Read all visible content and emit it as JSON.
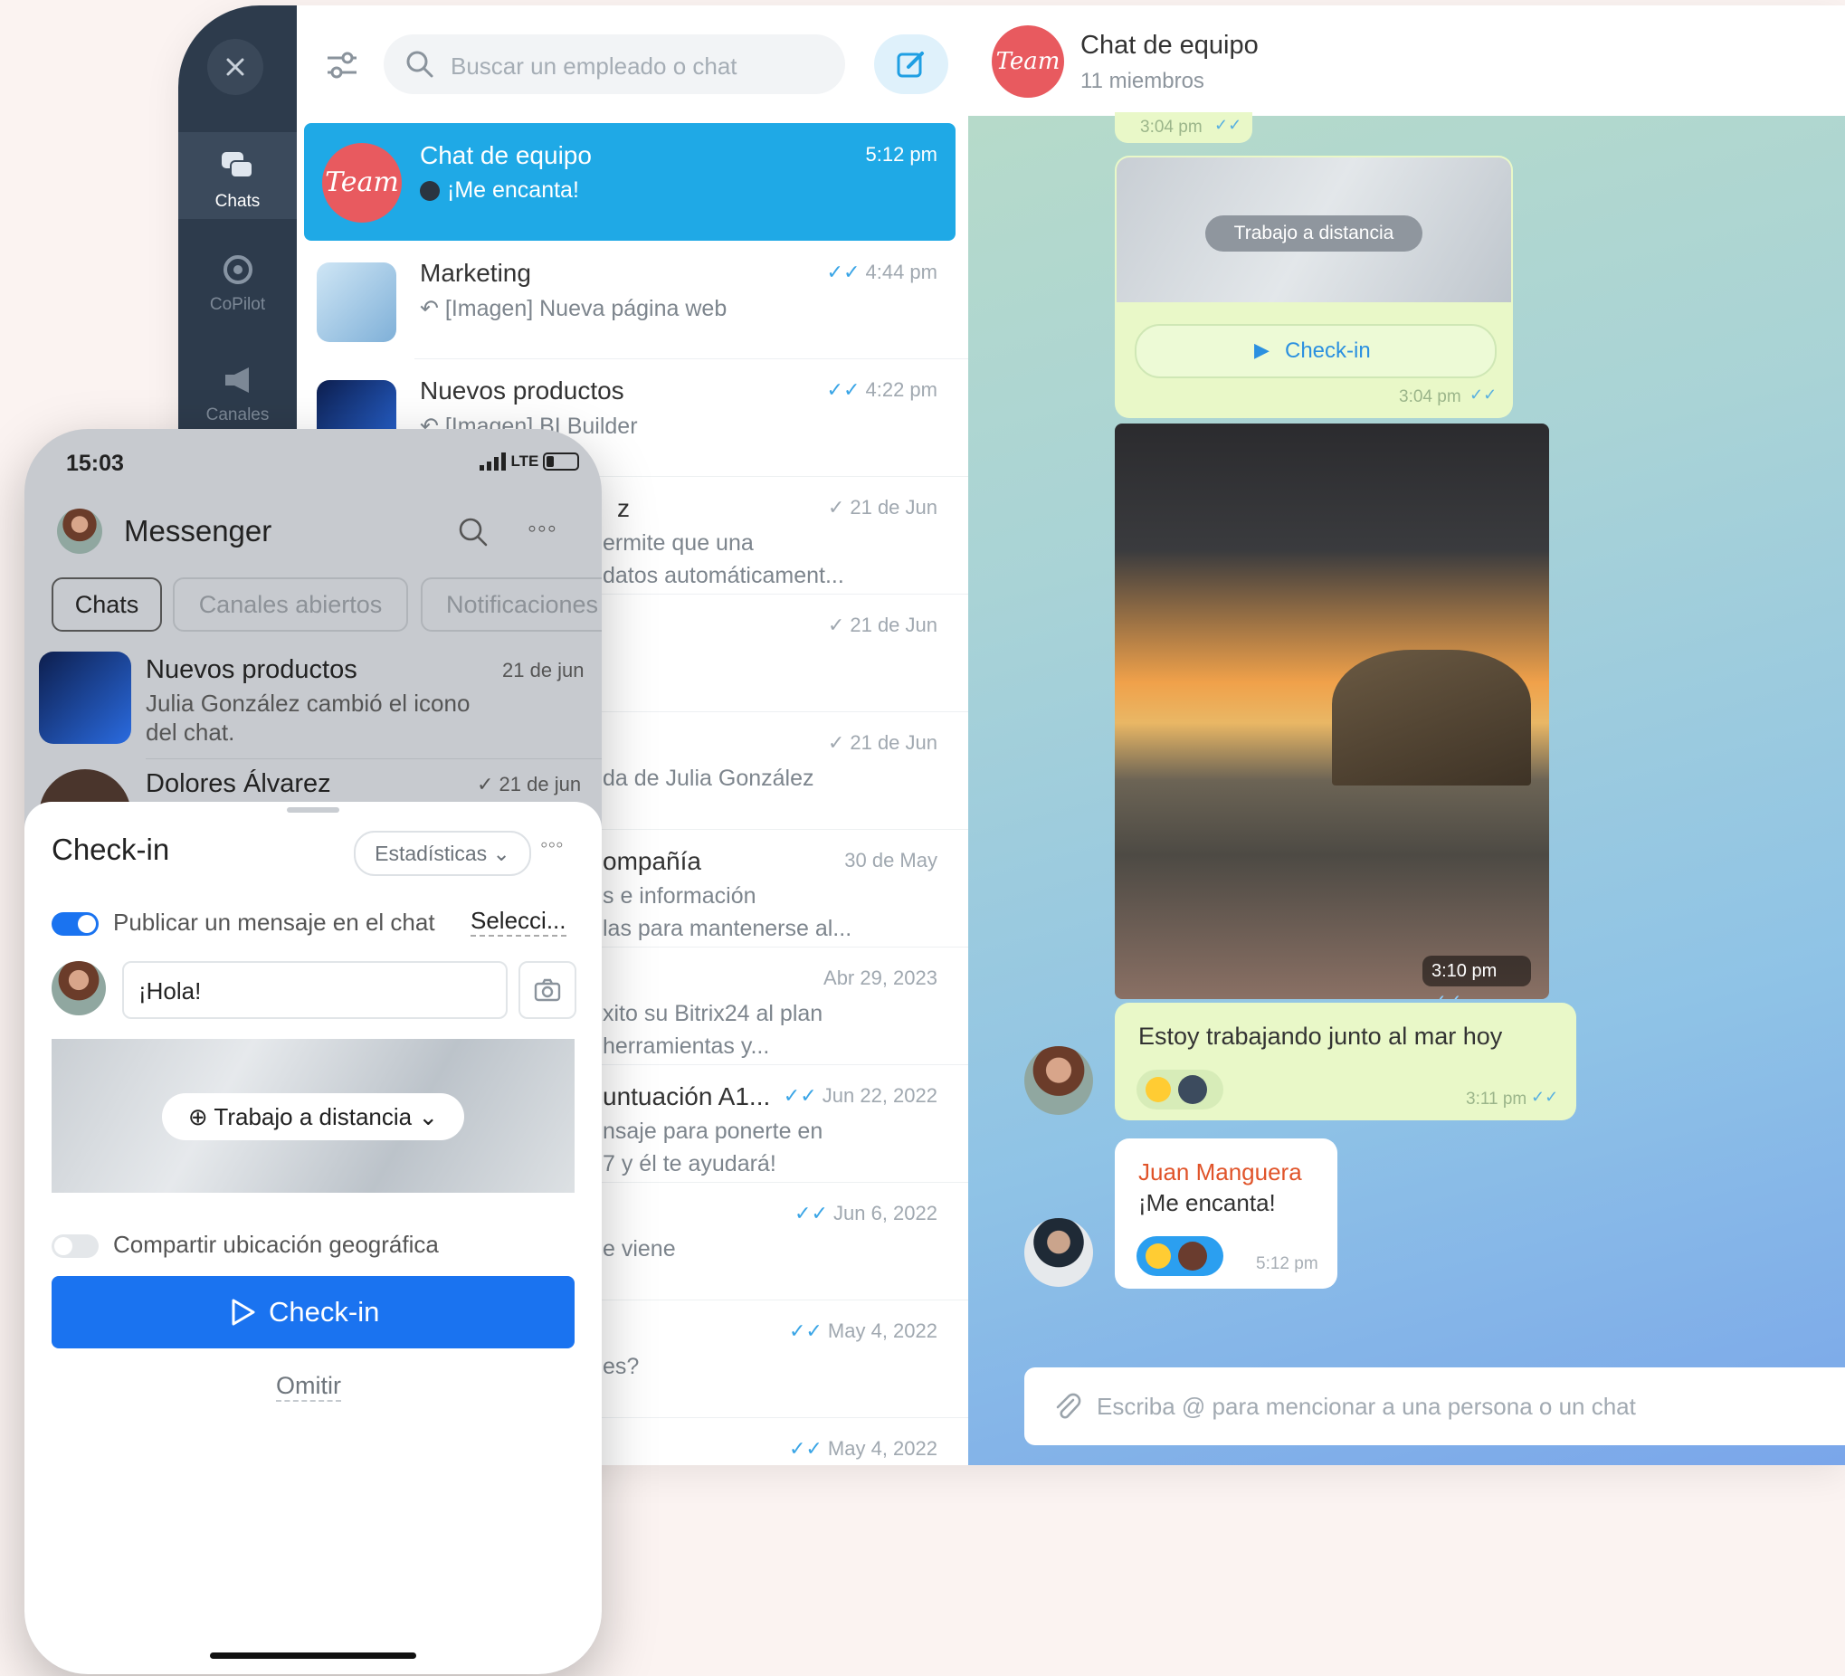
{
  "desktop": {
    "nav": [
      {
        "label": "Chats",
        "icon": "chats-icon"
      },
      {
        "label": "CoPilot",
        "icon": "copilot-icon"
      },
      {
        "label": "Canales",
        "icon": "megaphone-icon"
      }
    ],
    "search_placeholder": "Buscar un empleado o chat",
    "chats": [
      {
        "name": "Chat de equipo",
        "time": "5:12 pm",
        "preview": "¡Me encanta!",
        "selected": true
      },
      {
        "name": "Marketing",
        "time": "4:44 pm",
        "preview": "[Imagen] Nueva página web"
      },
      {
        "name": "Nuevos productos",
        "time": "4:22 pm",
        "preview": "[Imagen] BI Builder"
      },
      {
        "name": "z",
        "time": "21 de Jun",
        "preview": "ermite que una",
        "preview2": "datos automáticament..."
      },
      {
        "name": "",
        "time": "21 de Jun",
        "preview": ""
      },
      {
        "name": "",
        "time": "21 de Jun",
        "preview": "da de Julia González"
      },
      {
        "name": "ompañía",
        "time": "30 de May",
        "preview": "s e información",
        "preview2": "las para mantenerse al..."
      },
      {
        "name": "",
        "time": "Abr 29, 2023",
        "preview": "xito su Bitrix24 al plan",
        "preview2": "herramientas y..."
      },
      {
        "name": "untuación A1...",
        "time": "Jun 22, 2022",
        "preview": "nsaje para ponerte en",
        "preview2": "7 y él te ayudará!"
      },
      {
        "name": "",
        "time": "Jun 6, 2022",
        "preview": "e viene"
      },
      {
        "name": "",
        "time": "May 4, 2022",
        "preview": "es?"
      },
      {
        "name": "",
        "time": "May 4, 2022",
        "preview": ""
      }
    ],
    "header": {
      "title": "Chat de equipo",
      "subtitle": "11 miembros",
      "avatar_text": "Team"
    },
    "messages": {
      "t1": "3:04 pm",
      "location_label": "Trabajo a distancia",
      "checkin_label": "Check-in",
      "t2": "3:04 pm",
      "photo_time": "3:10 pm",
      "msg1_text": "Estoy trabajando junto al mar hoy",
      "msg1_time": "3:11 pm",
      "msg2_author": "Juan Manguera",
      "msg2_text": "¡Me encanta!",
      "msg2_time": "5:12 pm"
    },
    "composer_placeholder": "Escriba @ para mencionar a una persona o un chat"
  },
  "phone": {
    "clock": "15:03",
    "network": "LTE",
    "app_title": "Messenger",
    "tabs": [
      "Chats",
      "Canales abiertos",
      "Notificaciones"
    ],
    "list": [
      {
        "name": "Nuevos productos",
        "date": "21 de jun",
        "preview": "Julia González cambió el icono",
        "preview2": "del chat."
      },
      {
        "name": "Dolores Álvarez",
        "date": "21 de jun"
      }
    ],
    "sheet": {
      "title": "Check-in",
      "stats_label": "Estadísticas",
      "publish_label": "Publicar un mensaje en el chat",
      "select_label": "Selecci...",
      "message_value": "¡Hola!",
      "location_label": "Trabajo a distancia",
      "geo_label": "Compartir ubicación geográfica",
      "checkin_label": "Check-in",
      "skip_label": "Omitir"
    }
  },
  "colors": {
    "accent": "#1fa9e6",
    "primary_button": "#1a73f0",
    "brand_red": "#e85a5f",
    "nav_bg": "#2d3b4c",
    "bubble": "#e9f8c8"
  }
}
